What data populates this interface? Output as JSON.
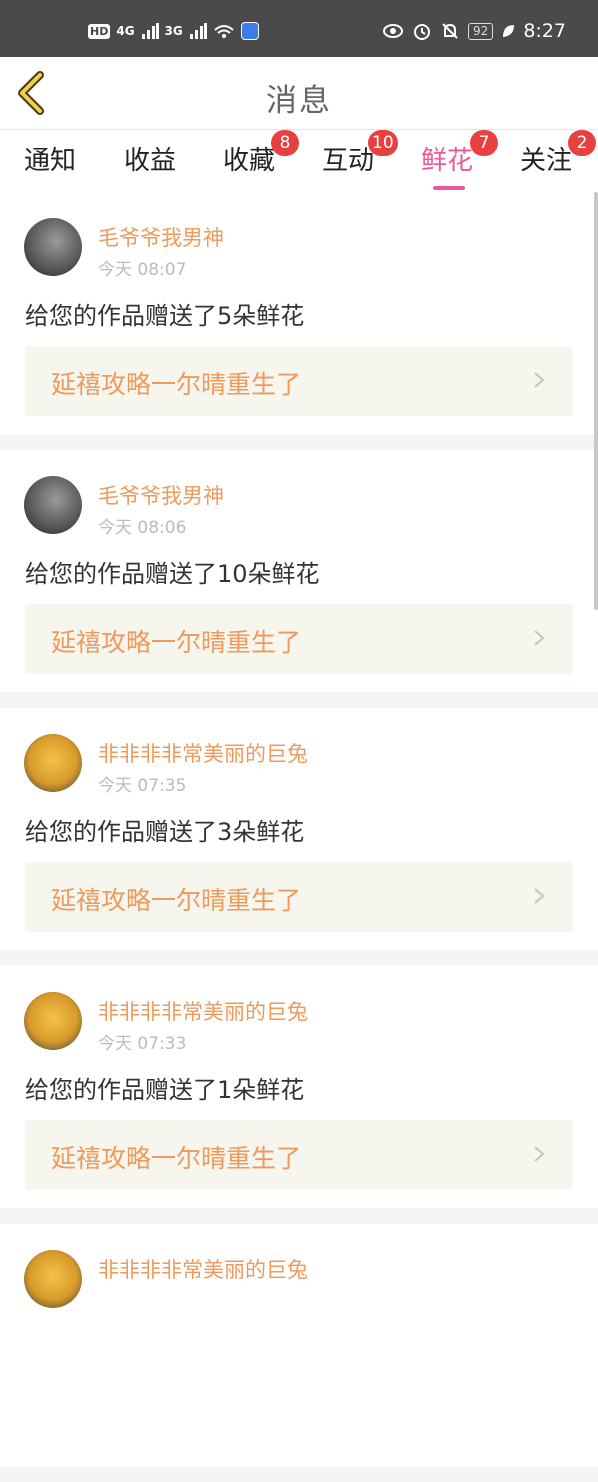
{
  "status_bar": {
    "hd": "HD",
    "net1": "4G",
    "net2": "3G",
    "battery": "92",
    "time": "8:27"
  },
  "header": {
    "title": "消息",
    "back_icon": "chevron-left-icon"
  },
  "tabs": [
    {
      "label": "通知",
      "badge": ""
    },
    {
      "label": "收益",
      "badge": ""
    },
    {
      "label": "收藏",
      "badge": "8"
    },
    {
      "label": "互动",
      "badge": "10"
    },
    {
      "label": "鲜花",
      "badge": "7",
      "active": true
    },
    {
      "label": "关注",
      "badge": "2"
    }
  ],
  "colors": {
    "accent_pink": "#e8599a",
    "badge_red": "#e84040",
    "name_orange": "#ef9a5a"
  },
  "messages": [
    {
      "user": "毛爷爷我男神",
      "time": "今天 08:07",
      "text": "给您的作品赠送了5朵鲜花",
      "work": "延禧攻略一尔晴重生了",
      "avatar": "girl"
    },
    {
      "user": "毛爷爷我男神",
      "time": "今天 08:06",
      "text": "给您的作品赠送了10朵鲜花",
      "work": "延禧攻略一尔晴重生了",
      "avatar": "girl"
    },
    {
      "user": "非非非非常美丽的巨兔",
      "time": "今天 07:35",
      "text": "给您的作品赠送了3朵鲜花",
      "work": "延禧攻略一尔晴重生了",
      "avatar": "smile"
    },
    {
      "user": "非非非非常美丽的巨兔",
      "time": "今天 07:33",
      "text": "给您的作品赠送了1朵鲜花",
      "work": "延禧攻略一尔晴重生了",
      "avatar": "smile"
    },
    {
      "user": "非非非非常美丽的巨兔",
      "time": "",
      "text": "",
      "work": "",
      "avatar": "smile"
    }
  ]
}
